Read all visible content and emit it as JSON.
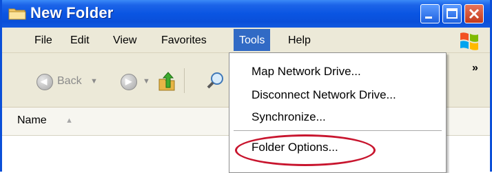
{
  "window": {
    "title": "New Folder"
  },
  "menubar": {
    "items": [
      "File",
      "Edit",
      "View",
      "Favorites",
      "Tools",
      "Help"
    ],
    "active": "Tools"
  },
  "toolbar": {
    "back_label": "Back",
    "overflow": "»"
  },
  "list": {
    "columns": [
      "Name"
    ]
  },
  "tools_menu": {
    "items": [
      "Map Network Drive...",
      "Disconnect Network Drive...",
      "Synchronize...",
      "Folder Options..."
    ],
    "highlighted": "Folder Options..."
  },
  "colors": {
    "titlebar": "#0A55E2",
    "menu_active": "#316AC5",
    "highlight_ring": "#C8152E"
  }
}
